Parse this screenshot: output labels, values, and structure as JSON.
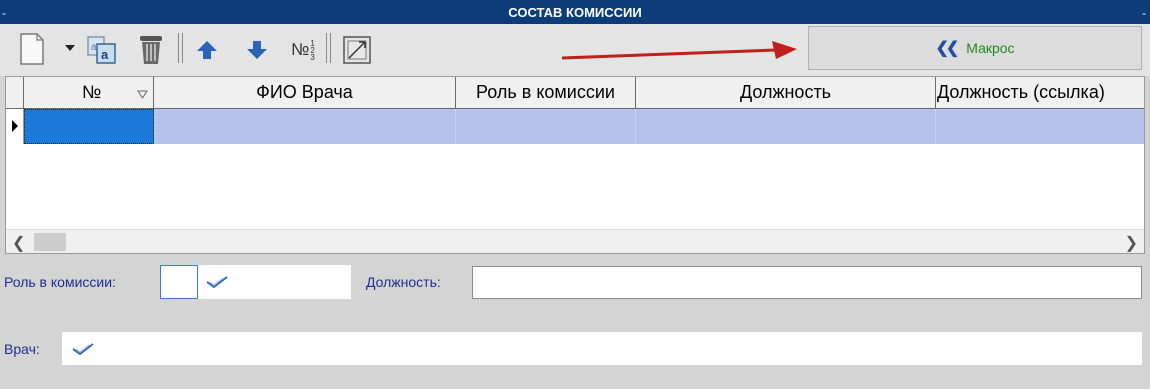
{
  "window": {
    "title": "СОСТАВ КОМИССИИ",
    "corner_left": "-",
    "corner_right": "-"
  },
  "toolbar": {
    "macro_label": "Макрос",
    "macro_icon": "double-chevron-left-icon",
    "number_label": "№"
  },
  "grid": {
    "columns": [
      "№",
      "ФИО Врача",
      "Роль в комиссии",
      "Должность",
      "Должность (ссылка)"
    ],
    "selected_row": [
      "",
      "",
      "",
      "",
      ""
    ]
  },
  "form": {
    "role_label": "Роль в комиссии:",
    "position_label": "Должность:",
    "doctor_label": "Врач:",
    "role_value": "",
    "position_value": "",
    "doctor_value": ""
  },
  "colors": {
    "title_bg": "#0d3d78",
    "selected_row": "#b4c2ec",
    "label_text": "#1e2f8f",
    "macro_text": "#1a8a1a",
    "arrow": "#c0201c"
  }
}
